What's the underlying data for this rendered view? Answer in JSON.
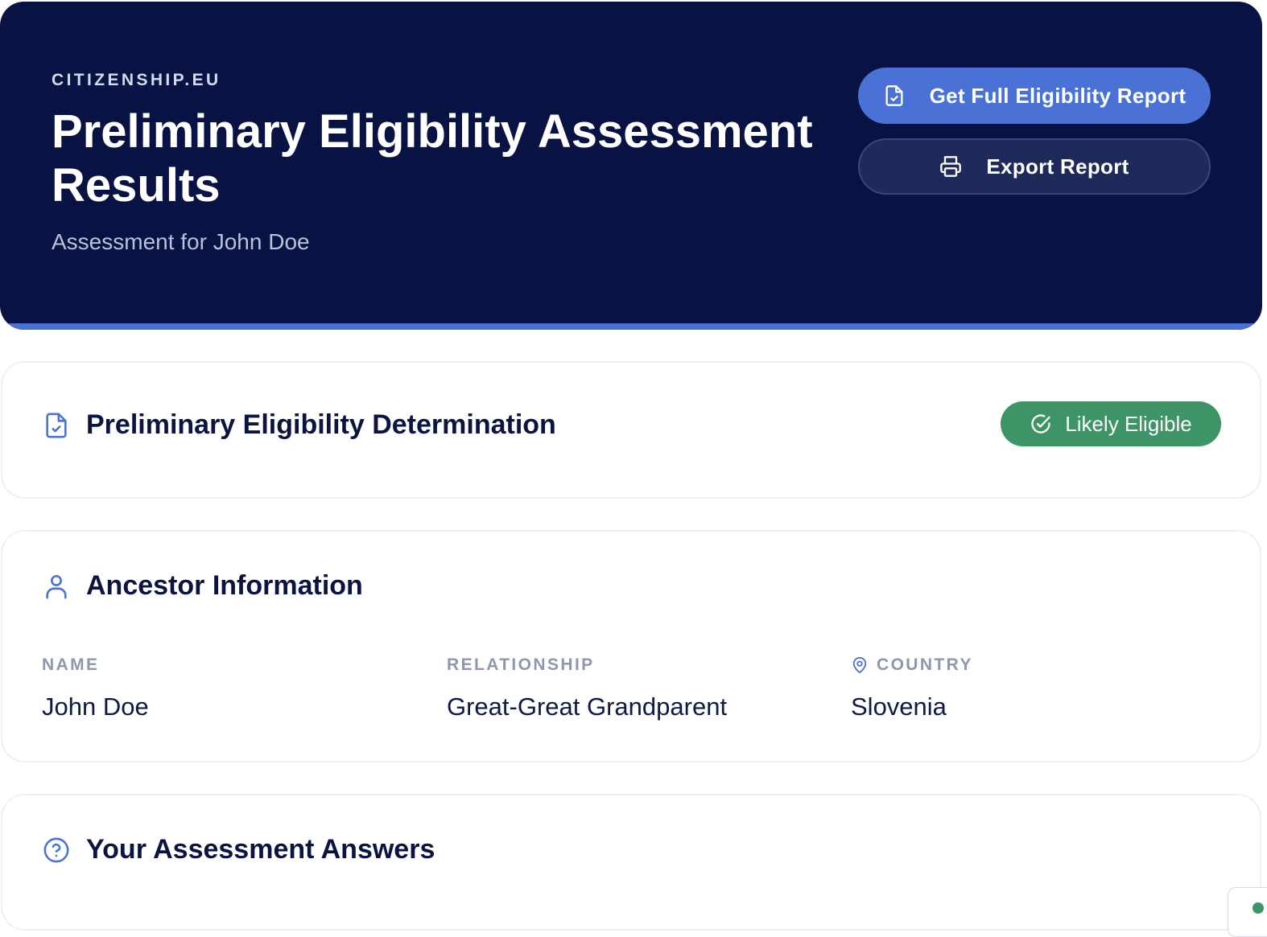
{
  "header": {
    "brand": "CITIZENSHIP.EU",
    "title": "Preliminary Eligibility Assessment Results",
    "subtitle": "Assessment for John Doe",
    "actions": {
      "primary_label": "Get Full Eligibility Report",
      "primary_icon": "file-check-icon",
      "secondary_label": "Export Report",
      "secondary_icon": "printer-icon"
    }
  },
  "determination": {
    "icon": "file-check-icon",
    "title": "Preliminary Eligibility Determination",
    "status": {
      "label": "Likely Eligible",
      "icon": "check-circle-icon",
      "color": "#3d9466"
    }
  },
  "ancestor": {
    "icon": "user-icon",
    "title": "Ancestor Information",
    "fields": {
      "name": {
        "label": "NAME",
        "value": "John Doe"
      },
      "relationship": {
        "label": "RELATIONSHIP",
        "value": "Great-Great Grandparent"
      },
      "country": {
        "label": "COUNTRY",
        "value": "Slovenia",
        "icon": "map-pin-icon"
      }
    }
  },
  "answers": {
    "icon": "help-circle-icon",
    "title": "Your Assessment Answers"
  },
  "colors": {
    "header_bg": "#081243",
    "accent": "#4a72d6",
    "success": "#3d9466",
    "text_dark": "#0b1440",
    "label_gray": "#8d97ad"
  }
}
